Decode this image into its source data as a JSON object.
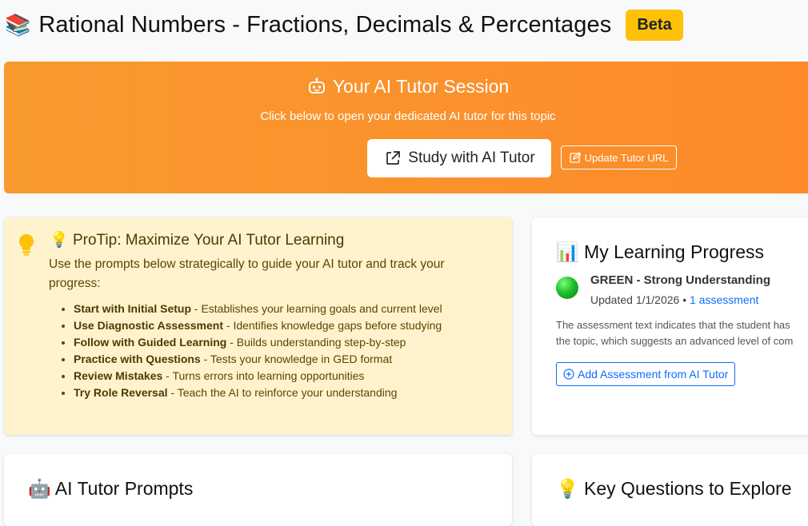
{
  "header": {
    "icon": "books-icon",
    "title": "Rational Numbers - Fractions, Decimals & Percentages",
    "badge": "Beta"
  },
  "tutor_session": {
    "icon": "robot-icon",
    "title": "Your AI Tutor Session",
    "subtitle": "Click below to open your dedicated AI tutor for this topic",
    "study_button": "Study with AI Tutor",
    "update_button": "Update Tutor URL"
  },
  "protip": {
    "title": "ProTip: Maximize Your AI Tutor Learning",
    "description": "Use the prompts below strategically to guide your AI tutor and track your progress:",
    "items": [
      {
        "bold": "Start with Initial Setup",
        "text": " - Establishes your learning goals and current level"
      },
      {
        "bold": "Use Diagnostic Assessment",
        "text": " - Identifies knowledge gaps before studying"
      },
      {
        "bold": "Follow with Guided Learning",
        "text": " - Builds understanding step-by-step"
      },
      {
        "bold": "Practice with Questions",
        "text": " - Tests your knowledge in GED format"
      },
      {
        "bold": "Review Mistakes",
        "text": " - Turns errors into learning opportunities"
      },
      {
        "bold": "Try Role Reversal",
        "text": " - Teach the AI to reinforce your understanding"
      }
    ]
  },
  "progress": {
    "title": "My Learning Progress",
    "status_title": "GREEN - Strong Understanding",
    "updated": "Updated 1/1/2026 • ",
    "assessment_link": "1 assessment",
    "assessment_line1": "The assessment text indicates that the student has",
    "assessment_line2": "the topic, which suggests an advanced level of com",
    "add_button": "Add Assessment from AI Tutor",
    "status_color": "#1fbf2c"
  },
  "prompts_card": {
    "title": "AI Tutor Prompts"
  },
  "questions_card": {
    "title": "Key Questions to Explore"
  },
  "colors": {
    "banner": "#fc8a2a",
    "badge": "#ffc107",
    "protip_bg": "#fff3cd",
    "link": "#0d6efd"
  }
}
